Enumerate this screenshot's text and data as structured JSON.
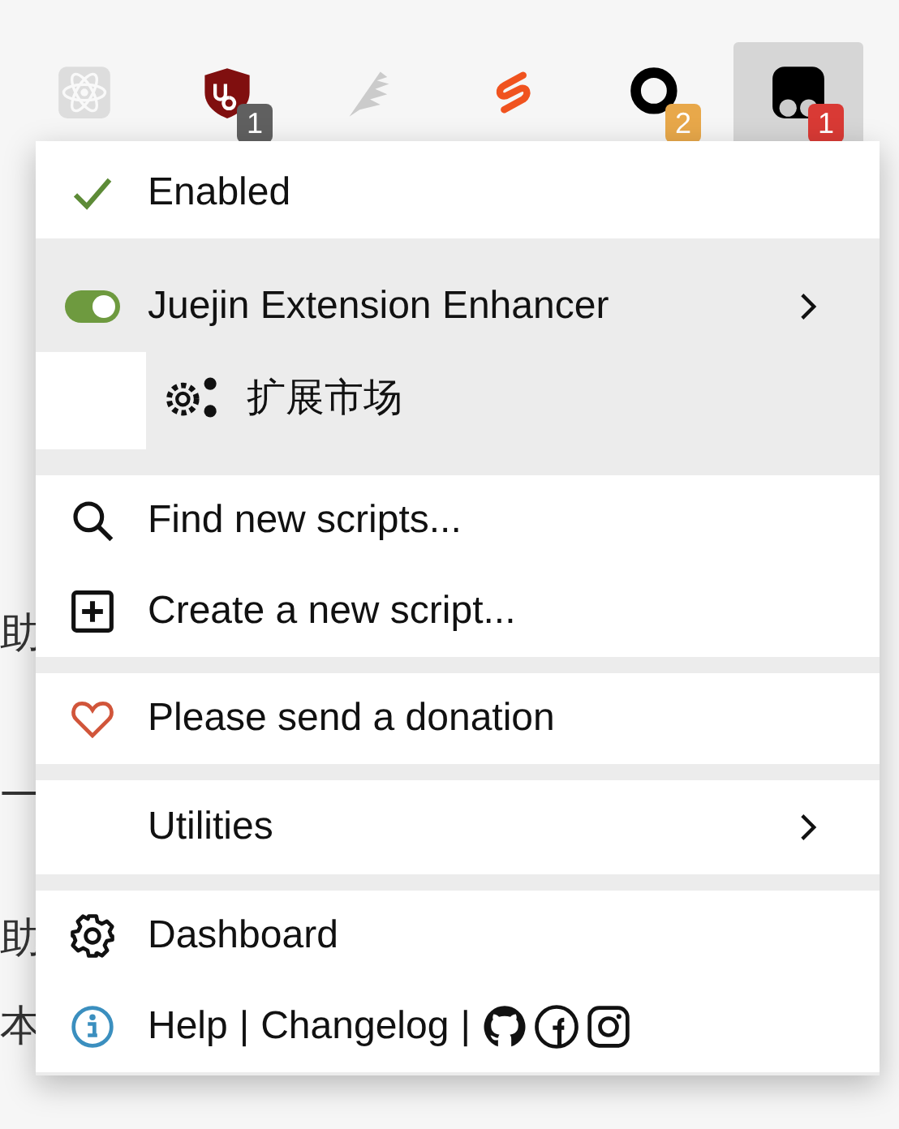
{
  "toolbar": {
    "extensions": [
      {
        "kind": "atom",
        "disabled": true,
        "selected": false
      },
      {
        "kind": "shield",
        "disabled": false,
        "selected": false,
        "badge": {
          "text": "1",
          "color": "#606060"
        }
      },
      {
        "kind": "feather",
        "disabled": true,
        "selected": false
      },
      {
        "kind": "s-logo",
        "disabled": false,
        "selected": false
      },
      {
        "kind": "ring",
        "disabled": false,
        "selected": false,
        "badge": {
          "text": "2",
          "color": "#e8a84a"
        }
      },
      {
        "kind": "dots",
        "disabled": false,
        "selected": true,
        "badge": {
          "text": "1",
          "color": "#d93a35"
        }
      }
    ]
  },
  "page_text_fragments": [
    "助",
    "一",
    "助",
    "本"
  ],
  "menu": {
    "sections": [
      {
        "highlighted": false,
        "items": [
          {
            "kind": "check",
            "label": "Enabled",
            "checked": true
          }
        ]
      },
      {
        "highlighted": true,
        "items": [
          {
            "kind": "script",
            "label": "Juejin Extension Enhancer",
            "on": true,
            "submenu": true
          },
          {
            "kind": "command",
            "label": "扩展市场"
          }
        ]
      },
      {
        "highlighted": false,
        "items": [
          {
            "kind": "search",
            "label": "Find new scripts..."
          },
          {
            "kind": "create",
            "label": "Create a new script..."
          }
        ]
      },
      {
        "highlighted": false,
        "items": [
          {
            "kind": "donate",
            "label": "Please send a donation"
          }
        ]
      },
      {
        "highlighted": false,
        "items": [
          {
            "kind": "plain",
            "label": "Utilities",
            "submenu": true
          }
        ]
      },
      {
        "highlighted": false,
        "items": [
          {
            "kind": "settings",
            "label": "Dashboard"
          },
          {
            "kind": "help",
            "parts": [
              "Help",
              "|",
              "Changelog",
              "|"
            ]
          }
        ]
      }
    ]
  }
}
